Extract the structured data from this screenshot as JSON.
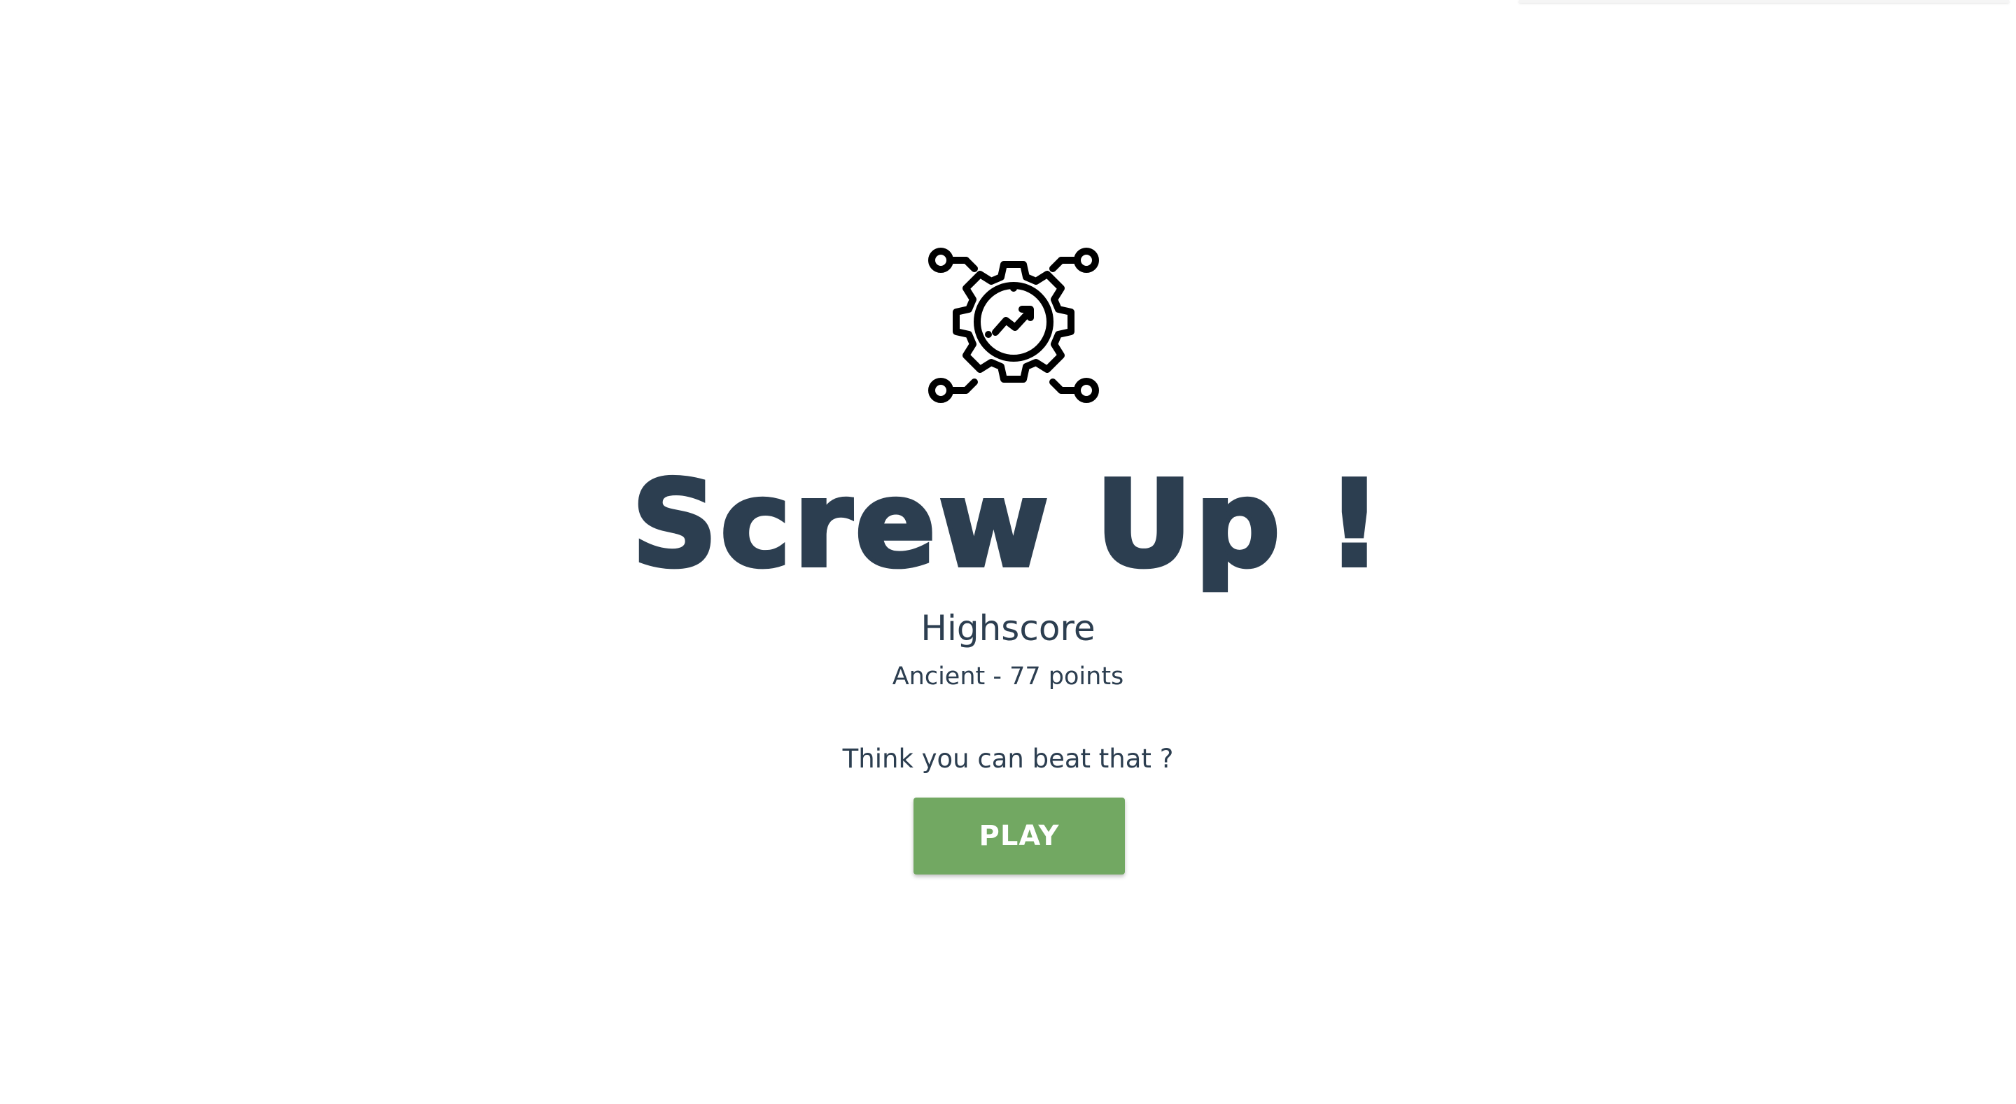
{
  "game": {
    "title": "Screw Up !",
    "logo_icon": "gear-growth-network-icon"
  },
  "highscore": {
    "label": "Highscore",
    "value": "Ancient - 77 points"
  },
  "challenge_text": "Think you can beat that ?",
  "play_button": {
    "label": "PLAY"
  },
  "colors": {
    "text": "#2c3e50",
    "play_button": "#72a862",
    "background": "#ffffff"
  }
}
